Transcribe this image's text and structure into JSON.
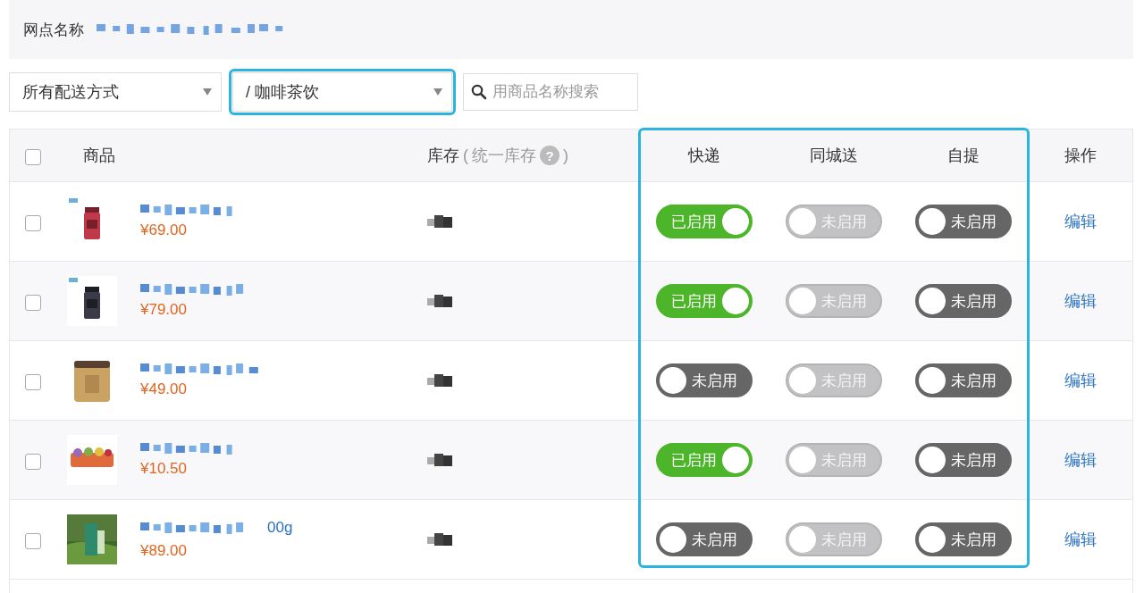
{
  "store": {
    "label": "网点名称"
  },
  "filters": {
    "delivery": {
      "value": "所有配送方式"
    },
    "category": {
      "value": "/ 咖啡茶饮"
    },
    "search": {
      "placeholder": "用商品名称搜索"
    }
  },
  "table": {
    "all_selected": false,
    "columns": {
      "product": "商品",
      "stock": "库存",
      "stock_note_open": "(",
      "stock_note": "统一库存",
      "stock_note_help": "?",
      "stock_note_close": ")",
      "express": "快递",
      "city": "同城送",
      "pickup": "自提",
      "action": "操作"
    },
    "rows": [
      {
        "selected": false,
        "price": "¥69.00",
        "toggles": [
          {
            "text": "已启用",
            "on": true,
            "disabled": false
          },
          {
            "text": "未启用",
            "on": false,
            "disabled": true
          },
          {
            "text": "未启用",
            "on": false,
            "disabled": false
          }
        ],
        "action": "编辑"
      },
      {
        "selected": false,
        "price": "¥79.00",
        "toggles": [
          {
            "text": "已启用",
            "on": true,
            "disabled": false
          },
          {
            "text": "未启用",
            "on": false,
            "disabled": true
          },
          {
            "text": "未启用",
            "on": false,
            "disabled": false
          }
        ],
        "action": "编辑"
      },
      {
        "selected": false,
        "price": "¥49.00",
        "toggles": [
          {
            "text": "未启用",
            "on": false,
            "disabled": false
          },
          {
            "text": "未启用",
            "on": false,
            "disabled": true
          },
          {
            "text": "未启用",
            "on": false,
            "disabled": false
          }
        ],
        "action": "编辑"
      },
      {
        "selected": false,
        "price": "¥10.50",
        "toggles": [
          {
            "text": "已启用",
            "on": true,
            "disabled": false
          },
          {
            "text": "未启用",
            "on": false,
            "disabled": true
          },
          {
            "text": "未启用",
            "on": false,
            "disabled": false
          }
        ],
        "action": "编辑"
      },
      {
        "selected": false,
        "name_tail": "00g",
        "price": "¥89.00",
        "toggles": [
          {
            "text": "未启用",
            "on": false,
            "disabled": false
          },
          {
            "text": "未启用",
            "on": false,
            "disabled": true
          },
          {
            "text": "未启用",
            "on": false,
            "disabled": false
          }
        ],
        "action": "编辑"
      }
    ]
  }
}
